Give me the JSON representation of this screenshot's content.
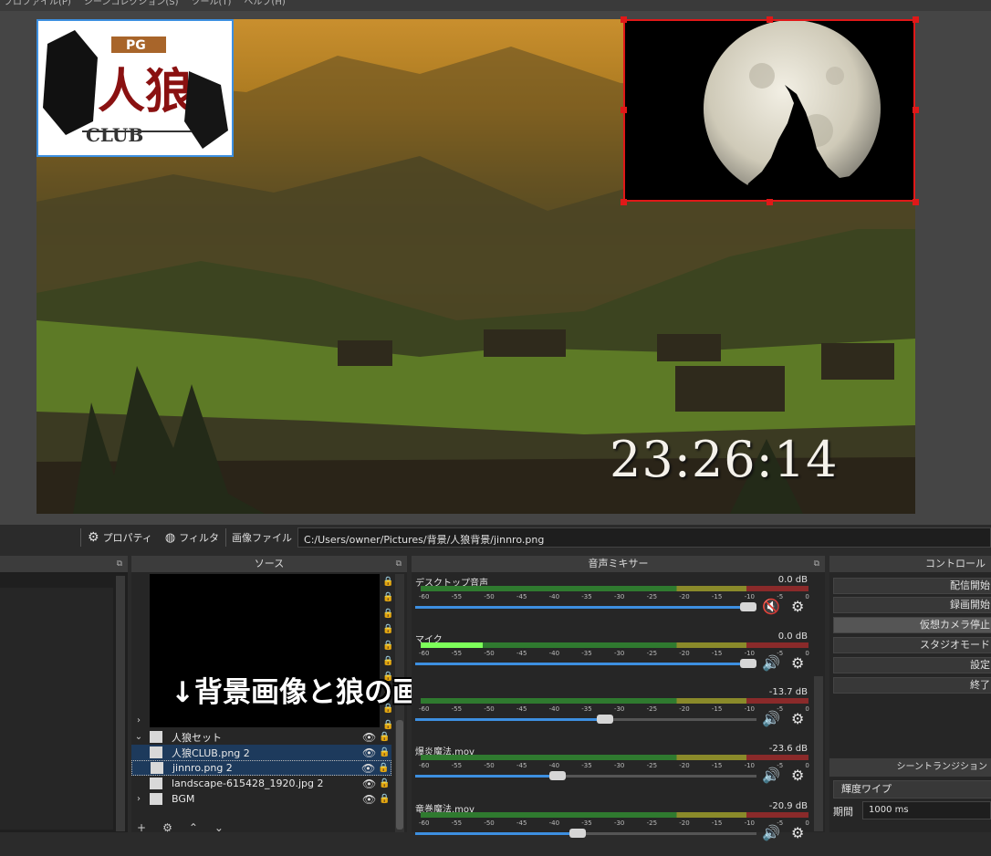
{
  "menubar": {
    "items": [
      "プロファイル(P)",
      "シーンコレクション(S)",
      "ツール(T)",
      "ヘルプ(H)"
    ]
  },
  "preview": {
    "clock": "23:26:14"
  },
  "propbar": {
    "properties_label": "プロパティ",
    "filters_label": "フィルタ",
    "image_file_label": "画像ファイル",
    "path": "C:/Users/owner/Pictures/背景/人狼背景/jinnro.png"
  },
  "sources": {
    "title": "ソース",
    "items": [
      {
        "label": "人狼セット"
      },
      {
        "label": "人狼CLUB.png 2"
      },
      {
        "label": "jinnro.png 2"
      },
      {
        "label": "landscape-615428_1920.jpg 2"
      },
      {
        "label": "BGM"
      }
    ],
    "annotation": "↓背景画像と狼の画像"
  },
  "mixer": {
    "title": "音声ミキサー",
    "ticks": [
      "-60",
      "-55",
      "-50",
      "-45",
      "-40",
      "-35",
      "-30",
      "-25",
      "-20",
      "-15",
      "-10",
      "-5",
      "0"
    ],
    "channels": [
      {
        "name": "デスクトップ音声",
        "db": "0.0 dB",
        "volume": 1.0,
        "level": 0.0,
        "muted": true
      },
      {
        "name": "マイク",
        "db": "0.0 dB",
        "volume": 1.0,
        "level": 0.16,
        "muted": false
      },
      {
        "name": "",
        "db": "-13.7 dB",
        "volume": 0.58,
        "level": 0.0,
        "muted": false
      },
      {
        "name": "爆炎魔法.mov",
        "db": "-23.6 dB",
        "volume": 0.44,
        "level": 0.0,
        "muted": false
      },
      {
        "name": "竜巻魔法.mov",
        "db": "-20.9 dB",
        "volume": 0.5,
        "level": 0.0,
        "muted": false
      }
    ]
  },
  "controls": {
    "title": "コントロール",
    "buttons": [
      "配信開始",
      "録画開始",
      "仮想カメラ停止",
      "スタジオモード",
      "設定",
      "終了"
    ],
    "transition_title": "シーントランジション",
    "transition": "輝度ワイプ",
    "duration_label": "期間",
    "duration": "1000 ms"
  },
  "colors": {
    "selection": "#e01818",
    "accent": "#3d8fe0"
  }
}
